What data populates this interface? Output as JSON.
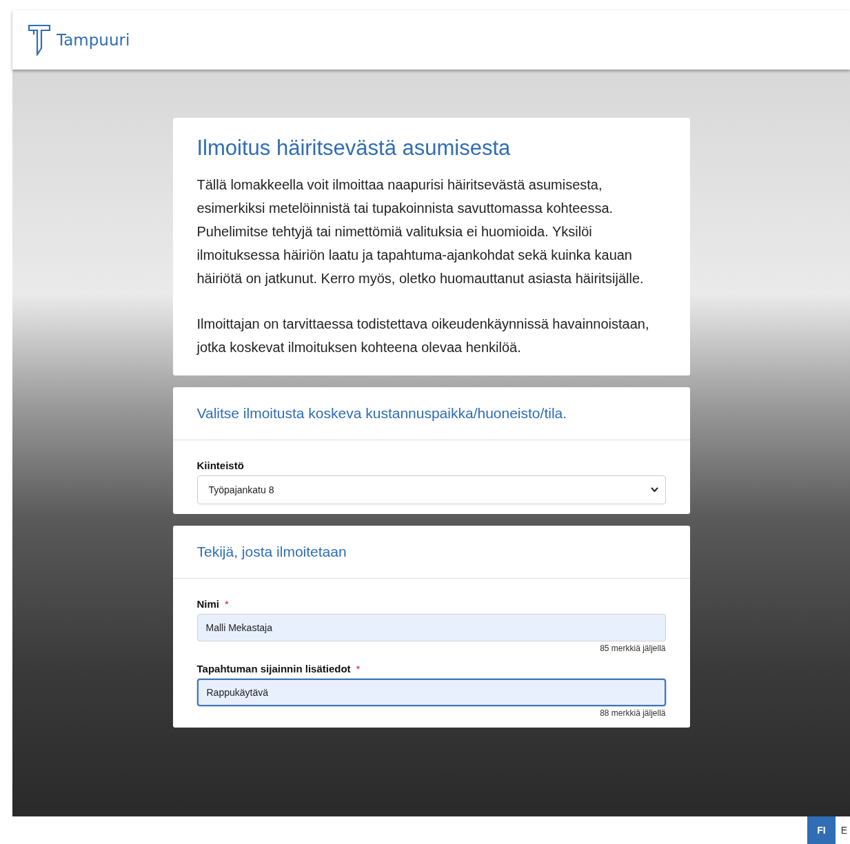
{
  "header": {
    "brand": "Tampuuri"
  },
  "intro": {
    "title": "Ilmoitus häiritsevästä asumisesta",
    "paragraphs": [
      "Tällä lomakkeella voit ilmoittaa naapurisi häiritsevästä asumisesta, esimerkiksi metelöinnistä tai tupakoinnista savuttomassa kohteessa. Puhelimitse tehtyjä tai nimettömiä valituksia ei huomioida. Yksilöi ilmoituksessa häiriön laatu ja tapahtuma-ajankohdat sekä kuinka kauan häiriötä on jatkunut. Kerro myös, oletko huomauttanut asiasta häiritsijälle.",
      "Ilmoittajan on tarvittaessa todistettava oikeudenkäynnissä havainnoistaan, jotka koskevat ilmoituksen kohteena olevaa henkilöä."
    ]
  },
  "sections": [
    {
      "title": "Valitse ilmoitusta koskeva kustannuspaikka/huoneisto/tila.",
      "fields": [
        {
          "kind": "select",
          "label": "Kiinteistö",
          "value": "Työpajankatu 8"
        }
      ]
    },
    {
      "title": "Tekijä, josta ilmoitetaan",
      "fields": [
        {
          "kind": "text",
          "label": "Nimi",
          "required_mark": "*",
          "value": "Malli Mekastaja",
          "focused": false,
          "counter": "85 merkkiä jäljellä"
        },
        {
          "kind": "text",
          "label": "Tapahtuman sijainnin lisätiedot",
          "required_mark": "*",
          "value": "Rappukäytävä",
          "focused": true,
          "counter": "88 merkkiä jäljellä"
        }
      ]
    }
  ],
  "languages": [
    {
      "label": "FI",
      "selected": true
    },
    {
      "label": "E",
      "selected": false
    }
  ]
}
